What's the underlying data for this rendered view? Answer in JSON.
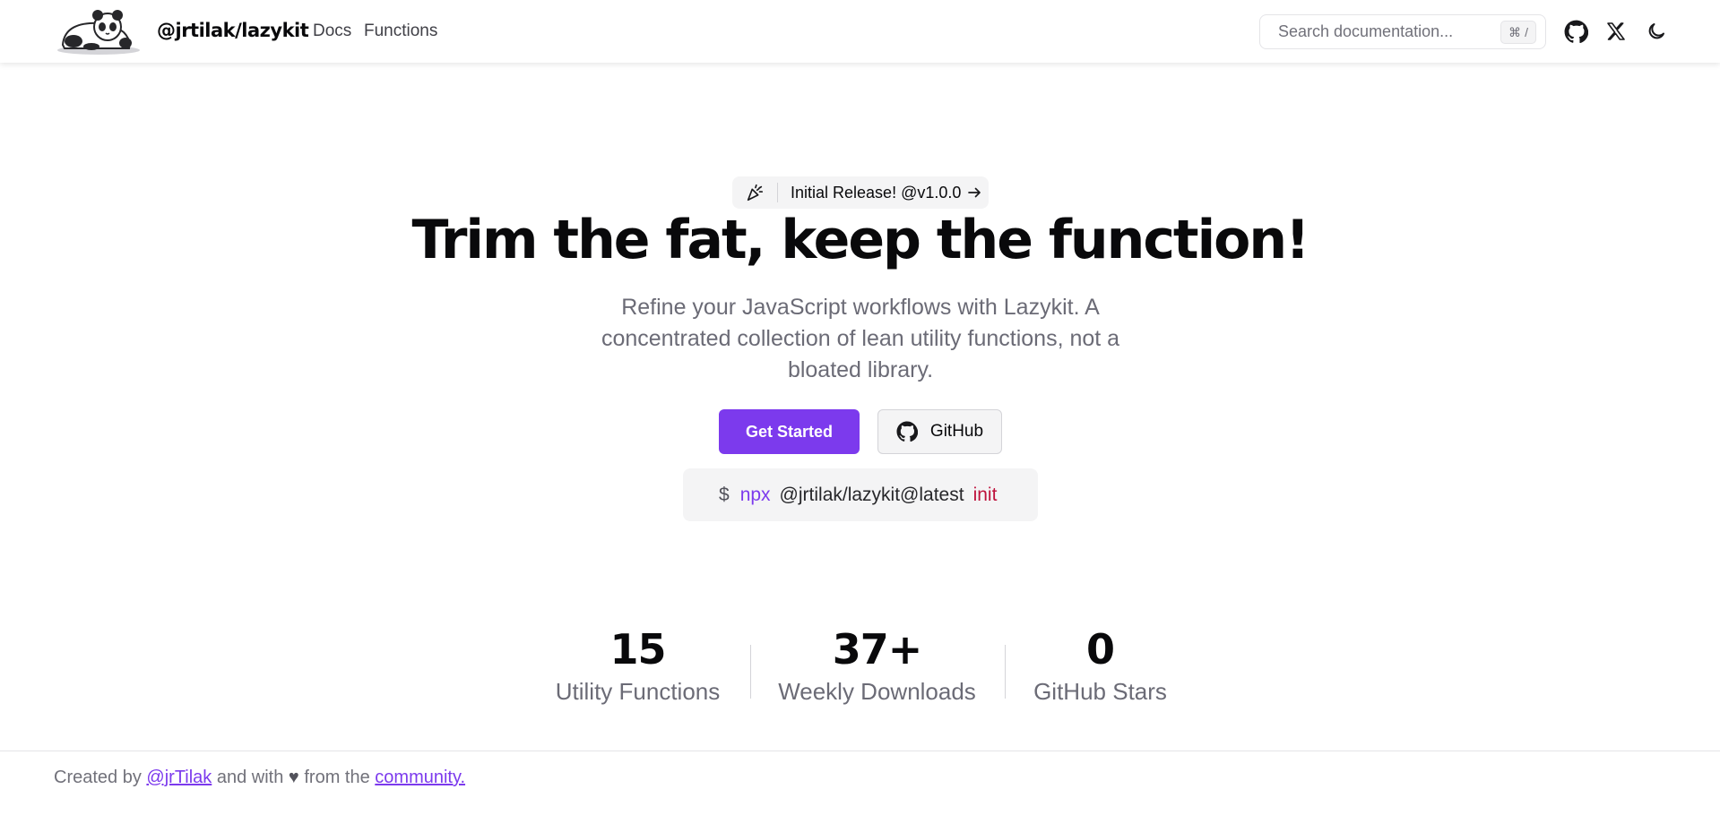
{
  "header": {
    "brand": "@jrtilak/lazykit",
    "nav": [
      "Docs",
      "Functions"
    ],
    "search": {
      "placeholder": "Search documentation...",
      "shortcut_symbol": "⌘",
      "shortcut_key": "/"
    }
  },
  "hero": {
    "badge": "Initial Release! @v1.0.0",
    "title": "Trim the fat, keep the function!",
    "subtitle": "Refine your JavaScript workflows with Lazykit. A concentrated collection of lean utility functions, not a bloated library.",
    "primary_button": "Get Started",
    "secondary_button": "GitHub",
    "command": {
      "prompt": "$",
      "tool": "npx",
      "package": "@jrtilak/lazykit@latest",
      "arg": "init"
    }
  },
  "stats": [
    {
      "value": "15",
      "label": "Utility Functions"
    },
    {
      "value": "37+",
      "label": "Weekly Downloads"
    },
    {
      "value": "0",
      "label": "GitHub Stars"
    }
  ],
  "footer": {
    "prefix": "Created by",
    "author": "@jrTilak",
    "middle": "and with",
    "heart": "♥",
    "suffix": "from the",
    "community": "community."
  },
  "colors": {
    "accent": "#7c3aed",
    "init": "#be123c"
  },
  "icons": [
    "panda-logo",
    "party-popper-icon",
    "arrow-right-icon",
    "github-icon",
    "x-icon",
    "moon-icon"
  ]
}
